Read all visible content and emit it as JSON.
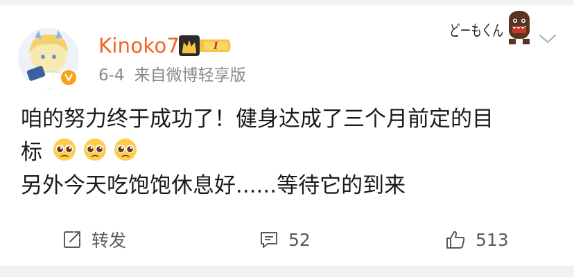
{
  "post": {
    "username": "Kinoko7",
    "vip_level": "I",
    "date": "6-4",
    "source": "来自微博轻享版",
    "lines": [
      "咱的努力终于成功了！健身达成了三个月前定的目",
      "标",
      "另外今天吃饱饱休息好......等待它的到来"
    ],
    "emojis": [
      "pleading-face",
      "pleading-face",
      "pleading-face"
    ]
  },
  "decor": {
    "sticker_text": "どーもくん"
  },
  "actions": {
    "share_label": "转发",
    "comment_count": "52",
    "like_count": "513"
  },
  "colors": {
    "username": "#f0641e",
    "verified_badge": "#f7a11c",
    "meta_text": "#8a8a8a",
    "body_text": "#1a1a1a",
    "action_text": "#5a5a5a",
    "divider": "#f2f2f2"
  },
  "icons": {
    "verified": "verified-badge-icon",
    "vip": "crown-vip-icon",
    "more": "chevron-down-icon",
    "share": "share-icon",
    "comment": "comment-icon",
    "like": "thumb-up-icon"
  }
}
